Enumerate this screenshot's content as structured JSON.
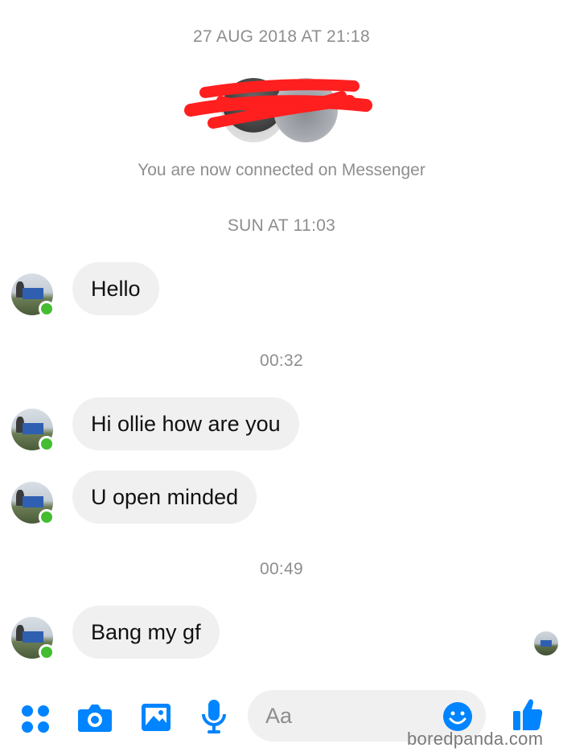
{
  "chat": {
    "top_timestamp": "27 AUG 2018 AT 21:18",
    "connected_notice": "You are now connected on Messenger",
    "items": [
      {
        "type": "timestamp",
        "text": "SUN AT 11:03"
      },
      {
        "type": "message",
        "sender": "other",
        "text": "Hello"
      },
      {
        "type": "timestamp",
        "text": "00:32"
      },
      {
        "type": "message",
        "sender": "other",
        "text": "Hi ollie how are you"
      },
      {
        "type": "message",
        "sender": "other",
        "text": "U open minded"
      },
      {
        "type": "timestamp",
        "text": "00:49"
      },
      {
        "type": "message",
        "sender": "other",
        "text": "Bang my gf"
      }
    ]
  },
  "composer": {
    "placeholder": "Aa",
    "icons": [
      "apps-icon",
      "camera-icon",
      "gallery-icon",
      "microphone-icon",
      "emoji-icon",
      "thumbs-up-icon"
    ]
  },
  "colors": {
    "accent": "#0084ff",
    "online": "#44bd32",
    "bubble": "#f1f0f0",
    "meta_text": "#8e8e8e",
    "redaction": "#ff1f1f"
  },
  "watermark": "boredpanda.com"
}
